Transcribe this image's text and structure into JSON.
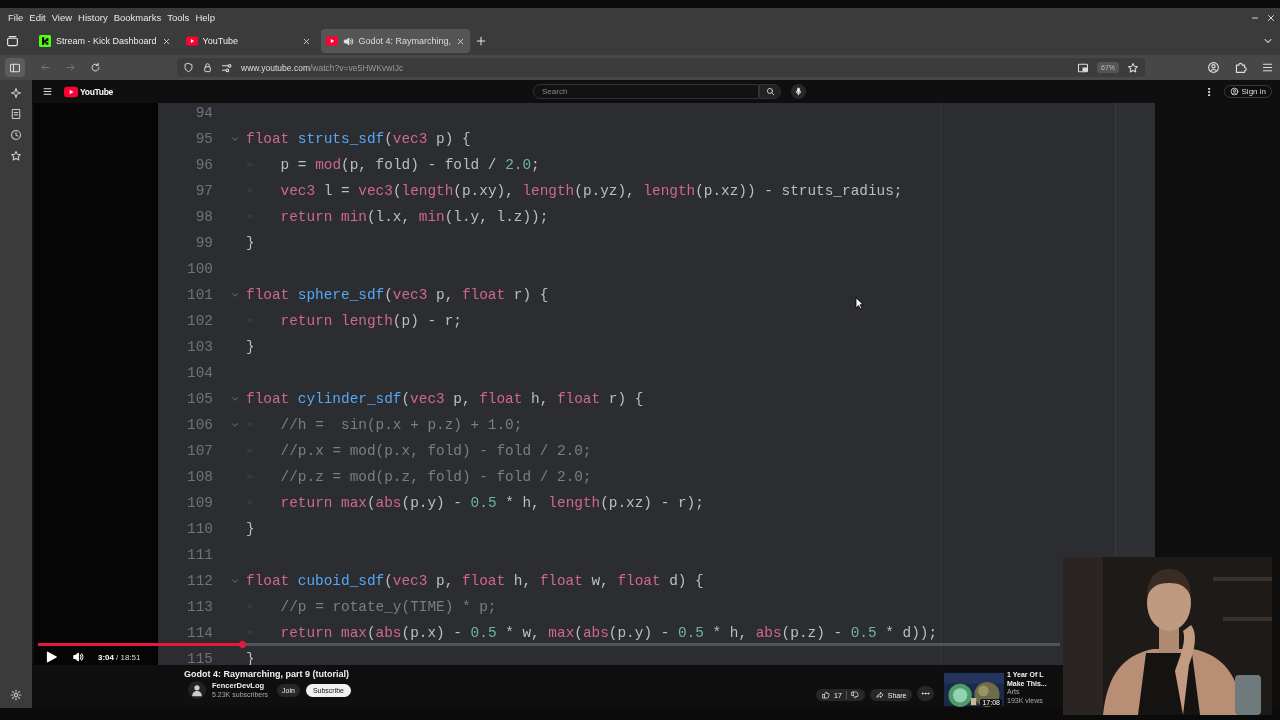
{
  "menu_bar": {
    "items": [
      "File",
      "Edit",
      "View",
      "History",
      "Bookmarks",
      "Tools",
      "Help"
    ]
  },
  "tabs": [
    {
      "title": "Stream - Kick Dashboard",
      "selected": false,
      "audio": false
    },
    {
      "title": "YouTube",
      "selected": false,
      "audio": false
    },
    {
      "title": "Godot 4: Raymarching,",
      "selected": true,
      "audio": true
    }
  ],
  "address_bar": {
    "url_host": "www.youtube.com",
    "url_path": "/watch?v=ve5HWKvwIJc",
    "zoom": "67%"
  },
  "youtube": {
    "logo_text": "YouTube",
    "search": {
      "placeholder": "Search"
    },
    "sign_in": "Sign in"
  },
  "code": {
    "lines": [
      {
        "number": "94",
        "fold": false,
        "indent": false
      },
      {
        "number": "95",
        "fold": true,
        "indent": false,
        "tokens": [
          {
            "kind": "keyword",
            "text": "float "
          },
          {
            "kind": "function",
            "text": "struts_sdf"
          },
          {
            "kind": "plain",
            "text": "("
          },
          {
            "kind": "keyword",
            "text": "vec3"
          },
          {
            "kind": "plain",
            "text": " p) {"
          }
        ]
      },
      {
        "number": "96",
        "fold": false,
        "indent": true,
        "tokens": [
          {
            "kind": "plain",
            "text": "p = "
          },
          {
            "kind": "keyword",
            "text": "mod"
          },
          {
            "kind": "plain",
            "text": "(p, fold) - fold / "
          },
          {
            "kind": "number",
            "text": "2.0"
          },
          {
            "kind": "plain",
            "text": ";"
          }
        ]
      },
      {
        "number": "97",
        "fold": false,
        "indent": true,
        "tokens": [
          {
            "kind": "keyword",
            "text": "vec3"
          },
          {
            "kind": "plain",
            "text": " l = "
          },
          {
            "kind": "keyword",
            "text": "vec3"
          },
          {
            "kind": "plain",
            "text": "("
          },
          {
            "kind": "keyword",
            "text": "length"
          },
          {
            "kind": "plain",
            "text": "(p.xy), "
          },
          {
            "kind": "keyword",
            "text": "length"
          },
          {
            "kind": "plain",
            "text": "(p.yz), "
          },
          {
            "kind": "keyword",
            "text": "length"
          },
          {
            "kind": "plain",
            "text": "(p.xz)) - struts_radius;"
          }
        ]
      },
      {
        "number": "98",
        "fold": false,
        "indent": true,
        "tokens": [
          {
            "kind": "keyword",
            "text": "return min"
          },
          {
            "kind": "plain",
            "text": "(l.x, "
          },
          {
            "kind": "keyword",
            "text": "min"
          },
          {
            "kind": "plain",
            "text": "(l.y, l.z));"
          }
        ]
      },
      {
        "number": "99",
        "fold": false,
        "indent": false,
        "tokens": [
          {
            "kind": "plain",
            "text": "}"
          }
        ]
      },
      {
        "number": "100",
        "fold": false,
        "indent": false
      },
      {
        "number": "101",
        "fold": true,
        "indent": false,
        "tokens": [
          {
            "kind": "keyword",
            "text": "float "
          },
          {
            "kind": "function",
            "text": "sphere_sdf"
          },
          {
            "kind": "plain",
            "text": "("
          },
          {
            "kind": "keyword",
            "text": "vec3"
          },
          {
            "kind": "plain",
            "text": " p, "
          },
          {
            "kind": "keyword",
            "text": "float"
          },
          {
            "kind": "plain",
            "text": " r) {"
          }
        ]
      },
      {
        "number": "102",
        "fold": false,
        "indent": true,
        "tokens": [
          {
            "kind": "keyword",
            "text": "return length"
          },
          {
            "kind": "plain",
            "text": "(p) - r;"
          }
        ]
      },
      {
        "number": "103",
        "fold": false,
        "indent": false,
        "tokens": [
          {
            "kind": "plain",
            "text": "}"
          }
        ]
      },
      {
        "number": "104",
        "fold": false,
        "indent": false
      },
      {
        "number": "105",
        "fold": true,
        "indent": false,
        "tokens": [
          {
            "kind": "keyword",
            "text": "float "
          },
          {
            "kind": "function",
            "text": "cylinder_sdf"
          },
          {
            "kind": "plain",
            "text": "("
          },
          {
            "kind": "keyword",
            "text": "vec3"
          },
          {
            "kind": "plain",
            "text": " p, "
          },
          {
            "kind": "keyword",
            "text": "float"
          },
          {
            "kind": "plain",
            "text": " h, "
          },
          {
            "kind": "keyword",
            "text": "float"
          },
          {
            "kind": "plain",
            "text": " r) {"
          }
        ]
      },
      {
        "number": "106",
        "fold": true,
        "indent": true,
        "tokens": [
          {
            "kind": "comment",
            "text": "//h =  sin(p.x + p.z) + 1.0;"
          }
        ]
      },
      {
        "number": "107",
        "fold": false,
        "indent": true,
        "tokens": [
          {
            "kind": "comment",
            "text": "//p.x = mod(p.x, fold) - fold / 2.0;"
          }
        ]
      },
      {
        "number": "108",
        "fold": false,
        "indent": true,
        "tokens": [
          {
            "kind": "comment",
            "text": "//p.z = mod(p.z, fold) - fold / 2.0;"
          }
        ]
      },
      {
        "number": "109",
        "fold": false,
        "indent": true,
        "tokens": [
          {
            "kind": "keyword",
            "text": "return max"
          },
          {
            "kind": "plain",
            "text": "("
          },
          {
            "kind": "keyword",
            "text": "abs"
          },
          {
            "kind": "plain",
            "text": "(p.y) - "
          },
          {
            "kind": "number",
            "text": "0.5"
          },
          {
            "kind": "plain",
            "text": " * h, "
          },
          {
            "kind": "keyword",
            "text": "length"
          },
          {
            "kind": "plain",
            "text": "(p.xz) - r);"
          }
        ]
      },
      {
        "number": "110",
        "fold": false,
        "indent": false,
        "tokens": [
          {
            "kind": "plain",
            "text": "}"
          }
        ]
      },
      {
        "number": "111",
        "fold": false,
        "indent": false
      },
      {
        "number": "112",
        "fold": true,
        "indent": false,
        "tokens": [
          {
            "kind": "keyword",
            "text": "float "
          },
          {
            "kind": "function",
            "text": "cuboid_sdf"
          },
          {
            "kind": "plain",
            "text": "("
          },
          {
            "kind": "keyword",
            "text": "vec3"
          },
          {
            "kind": "plain",
            "text": " p, "
          },
          {
            "kind": "keyword",
            "text": "float"
          },
          {
            "kind": "plain",
            "text": " h, "
          },
          {
            "kind": "keyword",
            "text": "float"
          },
          {
            "kind": "plain",
            "text": " w, "
          },
          {
            "kind": "keyword",
            "text": "float"
          },
          {
            "kind": "plain",
            "text": " d) {"
          }
        ]
      },
      {
        "number": "113",
        "fold": false,
        "indent": true,
        "tokens": [
          {
            "kind": "comment",
            "text": "//p = rotate_y(TIME) * p;"
          }
        ]
      },
      {
        "number": "114",
        "fold": false,
        "indent": true,
        "tokens": [
          {
            "kind": "keyword",
            "text": "return max"
          },
          {
            "kind": "plain",
            "text": "("
          },
          {
            "kind": "keyword",
            "text": "abs"
          },
          {
            "kind": "plain",
            "text": "(p.x) - "
          },
          {
            "kind": "number",
            "text": "0.5"
          },
          {
            "kind": "plain",
            "text": " * w, "
          },
          {
            "kind": "keyword",
            "text": "max"
          },
          {
            "kind": "plain",
            "text": "("
          },
          {
            "kind": "keyword",
            "text": "abs"
          },
          {
            "kind": "plain",
            "text": "(p.y) - "
          },
          {
            "kind": "number",
            "text": "0.5"
          },
          {
            "kind": "plain",
            "text": " * h, "
          },
          {
            "kind": "keyword",
            "text": "abs"
          },
          {
            "kind": "plain",
            "text": "(p.z) - "
          },
          {
            "kind": "number",
            "text": "0.5"
          },
          {
            "kind": "plain",
            "text": " * d));"
          }
        ]
      },
      {
        "number": "115",
        "fold": false,
        "indent": false,
        "tokens": [
          {
            "kind": "plain",
            "text": "}"
          }
        ]
      }
    ]
  },
  "player": {
    "playing": false,
    "level": 0.2,
    "time_current": "3:04",
    "time_total": "/ 18:51"
  },
  "video": {
    "title": "Godot 4: Raymarching, part 9 (tutorial)",
    "channel": "FencerDevLog",
    "subscribers": "5.23K subscribers",
    "join": "Join",
    "subscribe": "Subscribe",
    "likes": "17",
    "share": "Share"
  },
  "recommended": {
    "duration": "17:08",
    "title_lines": [
      "1 Year Of L",
      "Make This..."
    ],
    "channel": "Arts",
    "views": "193K views"
  }
}
